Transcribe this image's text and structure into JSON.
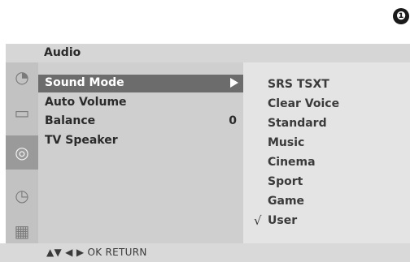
{
  "step_number": "❶",
  "menu": {
    "title": "Audio",
    "sidebar_icons": [
      {
        "name": "picture-icon",
        "glyph": "◔",
        "active": false
      },
      {
        "name": "screen-icon",
        "glyph": "▭",
        "active": false
      },
      {
        "name": "audio-icon",
        "glyph": "◎",
        "active": true
      },
      {
        "name": "time-icon",
        "glyph": "◷",
        "active": false
      },
      {
        "name": "option-icon",
        "glyph": "▦",
        "active": false
      }
    ],
    "items": [
      {
        "label": "Sound Mode",
        "value": "",
        "selected": true
      },
      {
        "label": "Auto Volume",
        "value": ""
      },
      {
        "label": "Balance",
        "value": "0"
      },
      {
        "label": "TV Speaker",
        "value": ""
      }
    ],
    "options": [
      {
        "label": "SRS TSXT",
        "checked": false
      },
      {
        "label": "Clear Voice",
        "checked": false
      },
      {
        "label": "Standard",
        "checked": false
      },
      {
        "label": "Music",
        "checked": false
      },
      {
        "label": "Cinema",
        "checked": false
      },
      {
        "label": "Sport",
        "checked": false
      },
      {
        "label": "Game",
        "checked": false
      },
      {
        "label": "User",
        "checked": true
      }
    ],
    "check_mark": "√",
    "help": "▲▼  ◀ ▶  OK  RETURN"
  }
}
